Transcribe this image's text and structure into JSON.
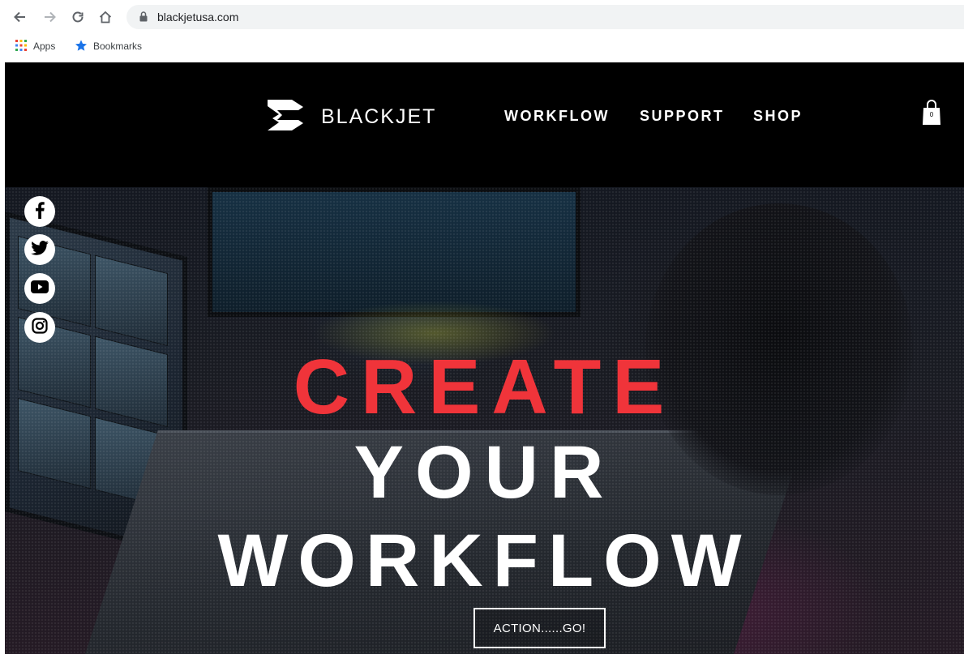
{
  "browser": {
    "url": "blackjetusa.com",
    "bookmarks": [
      {
        "label": "Apps",
        "icon": "apps-grid-icon"
      },
      {
        "label": "Bookmarks",
        "icon": "star-icon"
      }
    ]
  },
  "site": {
    "logo_text": "BLACKJET",
    "nav": [
      {
        "label": "WORKFLOW"
      },
      {
        "label": "SUPPORT"
      },
      {
        "label": "SHOP"
      }
    ],
    "cart_count": "0"
  },
  "social": [
    "facebook-icon",
    "twitter-icon",
    "youtube-icon",
    "instagram-icon"
  ],
  "hero": {
    "line1": "CREATE",
    "line2": "YOUR",
    "line3": "WORKFLOW",
    "cta_label": "ACTION......GO!"
  },
  "colors": {
    "accent_red": "#f0343a",
    "header_bg": "#000000",
    "text_white": "#ffffff",
    "chrome_grey": "#5f6368",
    "omnibox_bg": "#f1f3f4",
    "star_blue": "#1a73e8"
  }
}
